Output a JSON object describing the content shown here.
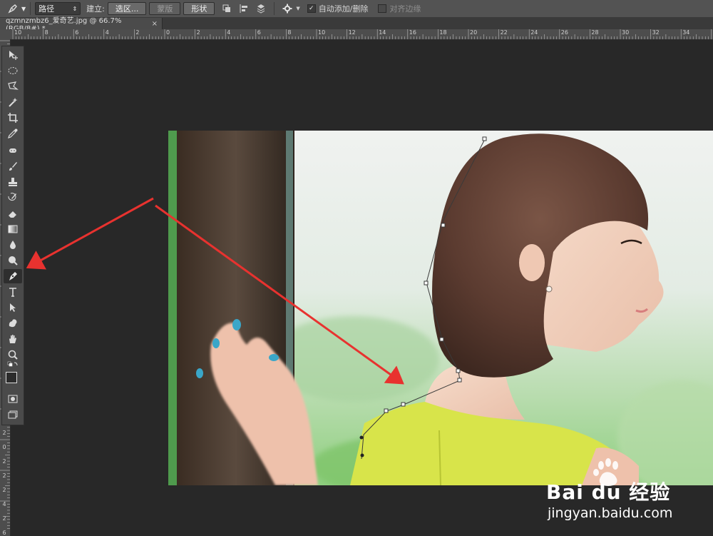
{
  "options_bar": {
    "mode_select": "路径",
    "make_label": "建立:",
    "selection_button": "选区...",
    "mask_button": "蒙版",
    "shape_button": "形状",
    "auto_add_delete_label": "自动添加/删除",
    "auto_add_delete_checked": true,
    "align_edges_label": "对齐边缘",
    "align_edges_checked": false
  },
  "document_tab": {
    "title": "qzmnzmbz6_爱奇艺.jpg @ 66.7%(RGB/8#) *",
    "close": "×"
  },
  "ruler": {
    "horizontal_labels": [
      "10",
      "8",
      "6",
      "4",
      "2",
      "0",
      "2",
      "4",
      "6",
      "8",
      "10",
      "12",
      "14",
      "16",
      "18",
      "20",
      "22",
      "24",
      "26",
      "28",
      "30",
      "32",
      "34"
    ],
    "vertical_labels": [
      "2",
      "0",
      "2",
      "2",
      "2",
      "4",
      "2",
      "6"
    ]
  },
  "toolbox": {
    "active_tool": "pen-tool"
  },
  "watermark": {
    "brand": "Bai du 经验",
    "url": "jingyan.baidu.com"
  },
  "annotations": {
    "arrow_color": "#e8322f"
  }
}
